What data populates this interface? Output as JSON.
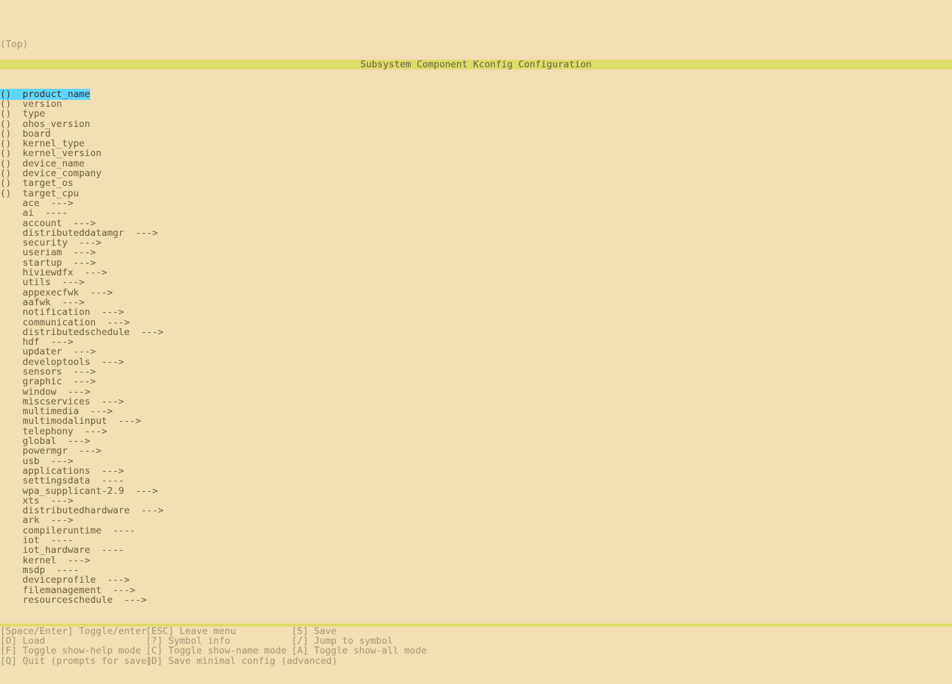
{
  "top": "(Top)",
  "title": "Subsystem Component Kconfig Configuration",
  "string_options": [
    "product_name",
    "version",
    "type",
    "ohos_version",
    "board",
    "kernel_type",
    "kernel_version",
    "device_name",
    "device_company",
    "target_os",
    "target_cpu"
  ],
  "submenus": [
    {
      "label": "ace",
      "arrow": "--->"
    },
    {
      "label": "ai",
      "arrow": "----"
    },
    {
      "label": "account",
      "arrow": "--->"
    },
    {
      "label": "distributeddatamgr",
      "arrow": "--->"
    },
    {
      "label": "security",
      "arrow": "--->"
    },
    {
      "label": "useriam",
      "arrow": "--->"
    },
    {
      "label": "startup",
      "arrow": "--->"
    },
    {
      "label": "hiviewdfx",
      "arrow": "--->"
    },
    {
      "label": "utils",
      "arrow": "--->"
    },
    {
      "label": "appexecfwk",
      "arrow": "--->"
    },
    {
      "label": "aafwk",
      "arrow": "--->"
    },
    {
      "label": "notification",
      "arrow": "--->"
    },
    {
      "label": "communication",
      "arrow": "--->"
    },
    {
      "label": "distributedschedule",
      "arrow": "--->"
    },
    {
      "label": "hdf",
      "arrow": "--->"
    },
    {
      "label": "updater",
      "arrow": "--->"
    },
    {
      "label": "developtools",
      "arrow": "--->"
    },
    {
      "label": "sensors",
      "arrow": "--->"
    },
    {
      "label": "graphic",
      "arrow": "--->"
    },
    {
      "label": "window",
      "arrow": "--->"
    },
    {
      "label": "miscservices",
      "arrow": "--->"
    },
    {
      "label": "multimedia",
      "arrow": "--->"
    },
    {
      "label": "multimodalinput",
      "arrow": "--->"
    },
    {
      "label": "telephony",
      "arrow": "--->"
    },
    {
      "label": "global",
      "arrow": "--->"
    },
    {
      "label": "powermgr",
      "arrow": "--->"
    },
    {
      "label": "usb",
      "arrow": "--->"
    },
    {
      "label": "applications",
      "arrow": "--->"
    },
    {
      "label": "settingsdata",
      "arrow": "----"
    },
    {
      "label": "wpa_supplicant-2.9",
      "arrow": "--->"
    },
    {
      "label": "xts",
      "arrow": "--->"
    },
    {
      "label": "distributedhardware",
      "arrow": "--->"
    },
    {
      "label": "ark",
      "arrow": "--->"
    },
    {
      "label": "compileruntime",
      "arrow": "----"
    },
    {
      "label": "iot",
      "arrow": "----"
    },
    {
      "label": "iot_hardware",
      "arrow": "----"
    },
    {
      "label": "kernel",
      "arrow": "--->"
    },
    {
      "label": "msdp",
      "arrow": "----"
    },
    {
      "label": "deviceprofile",
      "arrow": "--->"
    },
    {
      "label": "filemanagement",
      "arrow": "--->"
    },
    {
      "label": "resourceschedule",
      "arrow": "--->"
    }
  ],
  "selected_index": 0,
  "footer": [
    [
      "[Space/Enter] Toggle/enter",
      "[ESC] Leave menu",
      "[S] Save"
    ],
    [
      "[O] Load",
      "[?] Symbol info",
      "[/] Jump to symbol"
    ],
    [
      "[F] Toggle show-help mode",
      "[C] Toggle show-name mode",
      "[A] Toggle show-all mode"
    ],
    [
      "[Q] Quit (prompts for save)",
      "[D] Save minimal config (advanced)",
      ""
    ]
  ]
}
